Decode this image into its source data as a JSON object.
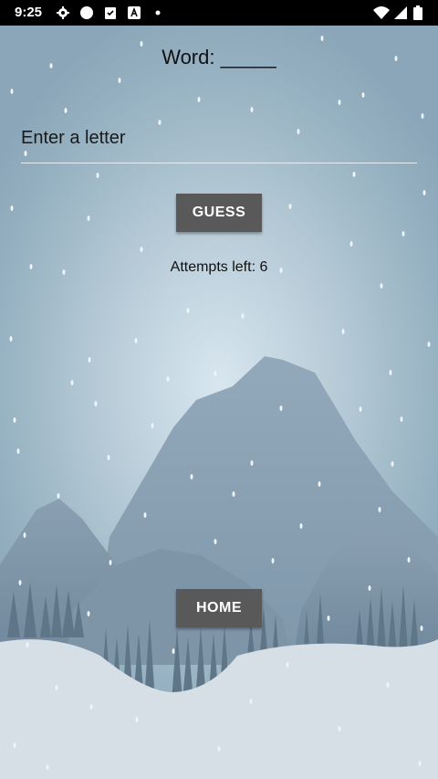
{
  "status_bar": {
    "time": "9:25"
  },
  "game": {
    "word_label": "Word: _____",
    "input_placeholder": "Enter a letter",
    "guess_button": "GUESS",
    "attempts_text": "Attempts left: 6",
    "home_button": "HOME"
  },
  "colors": {
    "button": "#595959",
    "text": "#111111",
    "sky": "#b5cad6",
    "snow": "#d6dfe5"
  }
}
